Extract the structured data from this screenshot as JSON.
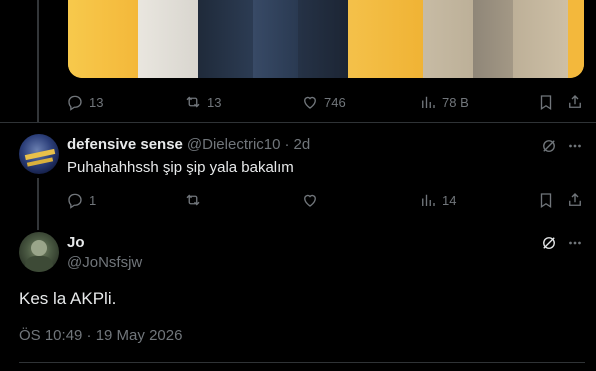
{
  "top_post": {
    "actions": {
      "replies": "13",
      "reposts": "13",
      "likes": "746",
      "views": "78 B"
    }
  },
  "reply1": {
    "name": "defensive sense",
    "handle": "@Dielectric10",
    "separator": "·",
    "time": "2d",
    "text": "Puhahahhssh şip şip yala bakalım",
    "actions": {
      "replies": "1",
      "reposts": "",
      "likes": "",
      "views": "14"
    }
  },
  "main_post": {
    "name": "Jo",
    "handle": "@JoNsfsjw",
    "text": "Kes la AKPli.",
    "timestamp": "ÖS 10:49 · 19 May 2026"
  },
  "colors": {
    "background": "#000000",
    "text_primary": "#e7e9ea",
    "text_secondary": "#71767b",
    "divider": "#2f3336"
  }
}
